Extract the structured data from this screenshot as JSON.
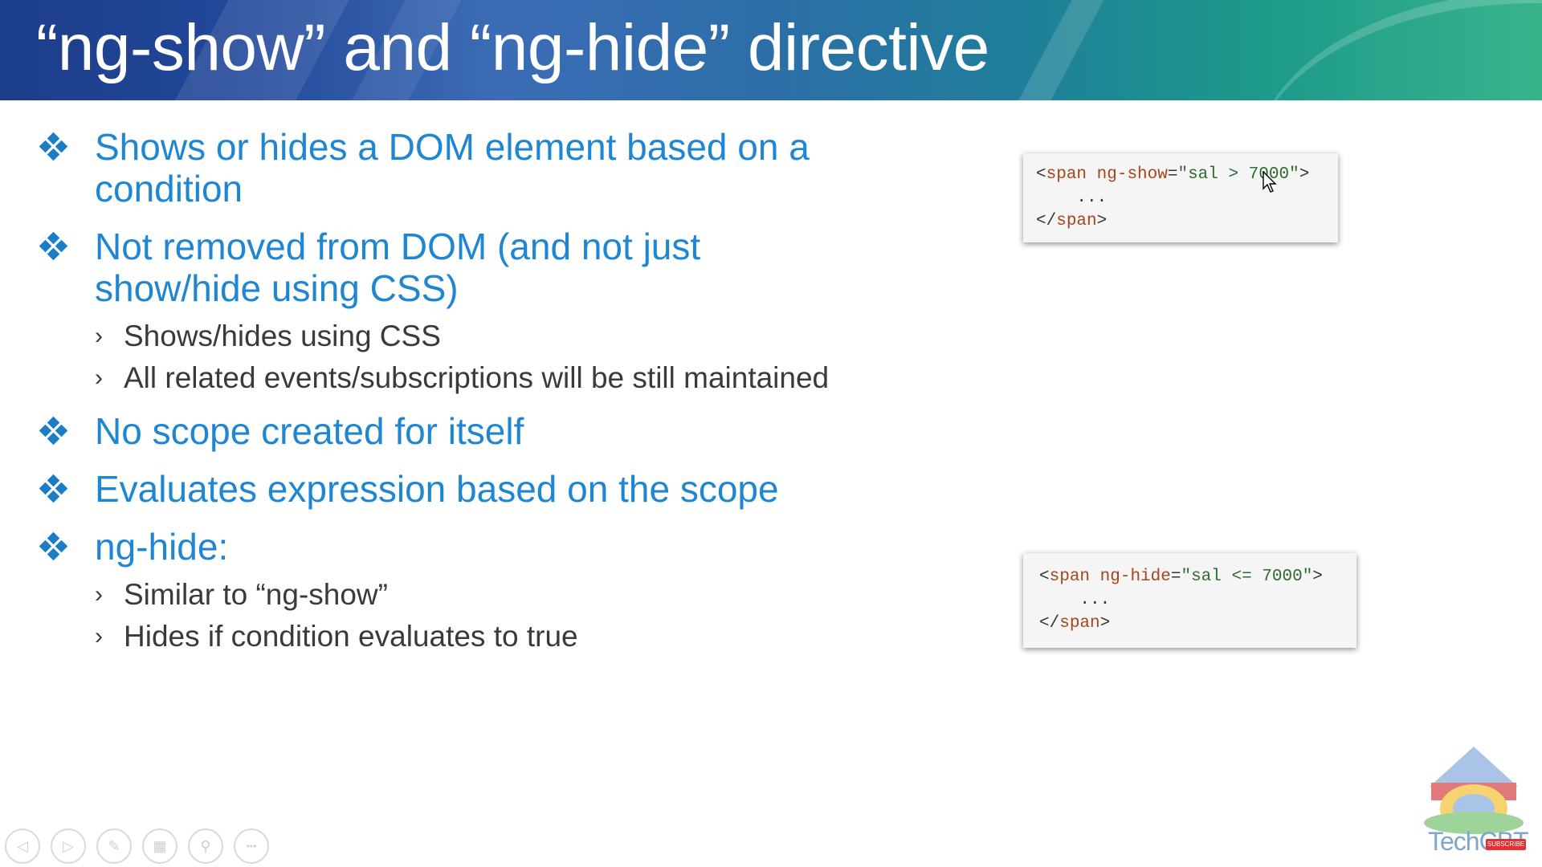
{
  "slide": {
    "title": "“ng-show” and “ng-hide” directive"
  },
  "bullets": {
    "b1_line1": "Shows or hides a DOM element based on a",
    "b1_line2": "condition",
    "b2_line1": "Not removed from DOM (and not just",
    "b2_line2": "show/hide using CSS)",
    "b2_sub1": "Shows/hides using CSS",
    "b2_sub2": "All related events/subscriptions will be still maintained",
    "b3": "No scope created for itself",
    "b4": "Evaluates expression based on the scope",
    "b5": "ng-hide:",
    "b5_sub1": "Similar to “ng-show”",
    "b5_sub2": "Hides if condition evaluates to true"
  },
  "code_show": {
    "open": "<",
    "tag": "span",
    "attr": " ng-show",
    "eq": "=",
    "value": "\"sal > 7000\"",
    "close": ">",
    "body": "    ...",
    "end_open": "</",
    "end_tag": "span",
    "end_close": ">"
  },
  "code_hide": {
    "open": "<",
    "tag": "span",
    "attr": " ng-hide",
    "eq": "=",
    "value": "\"sal <= 7000\"",
    "close": ">",
    "body": "    ...",
    "end_open": "</",
    "end_tag": "span",
    "end_close": ">"
  },
  "toolbar": {
    "prev": "◁",
    "next": "▷",
    "pen": "✎",
    "slides": "▦",
    "zoom": "⚲",
    "more": "•••"
  },
  "logo": {
    "text": "TechCBT",
    "badge": "SUBSCRIBE"
  },
  "icons": {
    "bullet": "diamond-cluster-icon",
    "sub_bullet": "chevron-right-icon",
    "cursor": "mouse-pointer-icon"
  },
  "colors": {
    "heading_blue": "#1f86d2",
    "body_text": "#3a3a3a",
    "code_tag": "#a6451c",
    "code_string": "#2e6b2e"
  }
}
